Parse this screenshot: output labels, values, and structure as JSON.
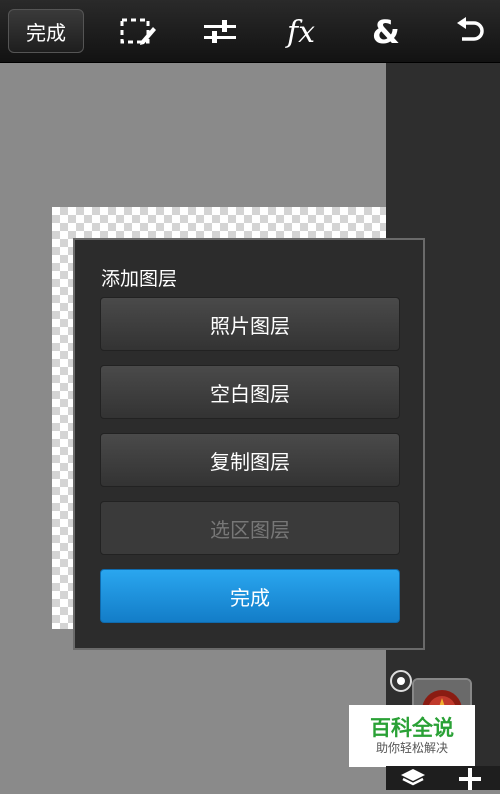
{
  "toolbar": {
    "done_label": "完成",
    "icons": [
      "selection-edit-icon",
      "adjustments-icon",
      "fx-icon",
      "blend-icon",
      "undo-icon"
    ],
    "fx_text": "fx",
    "amp_text": "&"
  },
  "dialog": {
    "title": "添加图层",
    "buttons": [
      {
        "label": "照片图层",
        "enabled": true
      },
      {
        "label": "空白图层",
        "enabled": true
      },
      {
        "label": "复制图层",
        "enabled": true
      },
      {
        "label": "选区图层",
        "enabled": false
      }
    ],
    "done_label": "完成"
  },
  "watermark": {
    "main": "百科全说",
    "sub": "助你轻松解决"
  },
  "colors": {
    "accent": "#1f8fdf",
    "toolbar_bg": "#1a1a1a",
    "canvas_bg": "#8a8a8a"
  }
}
